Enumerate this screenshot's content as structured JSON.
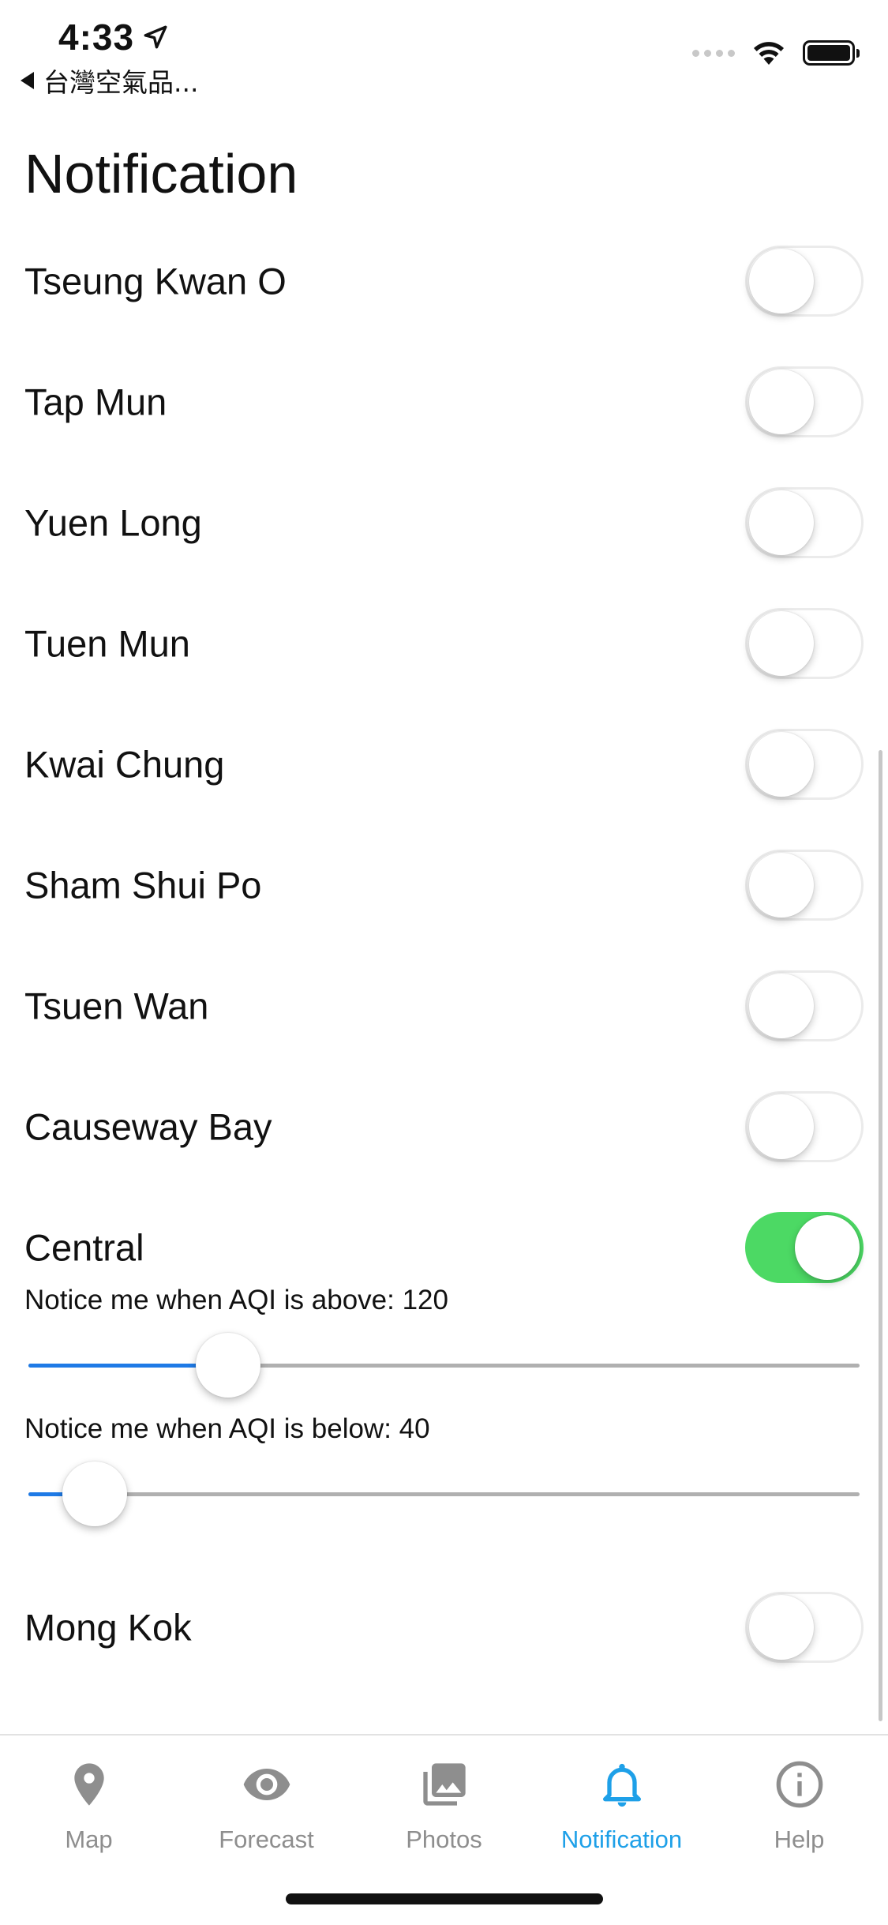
{
  "status_bar": {
    "time": "4:33",
    "back_label": "台灣空氣品..."
  },
  "page": {
    "title": "Notification"
  },
  "stations": [
    {
      "name": "Tseung Kwan O",
      "enabled": false
    },
    {
      "name": "Tap Mun",
      "enabled": false
    },
    {
      "name": "Yuen Long",
      "enabled": false
    },
    {
      "name": "Tuen Mun",
      "enabled": false
    },
    {
      "name": "Kwai Chung",
      "enabled": false
    },
    {
      "name": "Sham Shui Po",
      "enabled": false
    },
    {
      "name": "Tsuen Wan",
      "enabled": false
    },
    {
      "name": "Causeway Bay",
      "enabled": false
    },
    {
      "name": "Central",
      "enabled": true
    },
    {
      "name": "Mong Kok",
      "enabled": false
    }
  ],
  "central_settings": {
    "above_caption": "Notice me when AQI is above: 120",
    "above_value": 120,
    "below_caption": "Notice me when AQI is below: 40",
    "below_value": 40,
    "slider_max": 500
  },
  "tabs": [
    {
      "label": "Map",
      "icon": "map-pin-icon",
      "active": false
    },
    {
      "label": "Forecast",
      "icon": "eye-icon",
      "active": false
    },
    {
      "label": "Photos",
      "icon": "photos-icon",
      "active": false
    },
    {
      "label": "Notification",
      "icon": "bell-icon",
      "active": true
    },
    {
      "label": "Help",
      "icon": "info-icon",
      "active": false
    }
  ],
  "colors": {
    "toggle_on": "#4cd964",
    "slider_active": "#1e7ae6",
    "tab_active": "#1ea0e8",
    "tab_inactive": "#8e8e8e"
  }
}
